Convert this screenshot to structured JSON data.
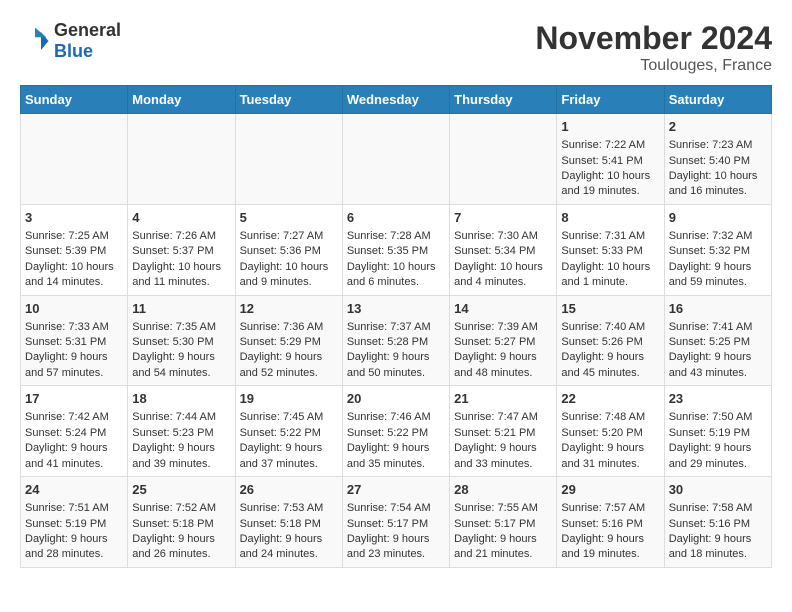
{
  "logo": {
    "general": "General",
    "blue": "Blue"
  },
  "title": "November 2024",
  "location": "Toulouges, France",
  "days_of_week": [
    "Sunday",
    "Monday",
    "Tuesday",
    "Wednesday",
    "Thursday",
    "Friday",
    "Saturday"
  ],
  "weeks": [
    [
      {
        "day": "",
        "info": ""
      },
      {
        "day": "",
        "info": ""
      },
      {
        "day": "",
        "info": ""
      },
      {
        "day": "",
        "info": ""
      },
      {
        "day": "",
        "info": ""
      },
      {
        "day": "1",
        "info": "Sunrise: 7:22 AM\nSunset: 5:41 PM\nDaylight: 10 hours and 19 minutes."
      },
      {
        "day": "2",
        "info": "Sunrise: 7:23 AM\nSunset: 5:40 PM\nDaylight: 10 hours and 16 minutes."
      }
    ],
    [
      {
        "day": "3",
        "info": "Sunrise: 7:25 AM\nSunset: 5:39 PM\nDaylight: 10 hours and 14 minutes."
      },
      {
        "day": "4",
        "info": "Sunrise: 7:26 AM\nSunset: 5:37 PM\nDaylight: 10 hours and 11 minutes."
      },
      {
        "day": "5",
        "info": "Sunrise: 7:27 AM\nSunset: 5:36 PM\nDaylight: 10 hours and 9 minutes."
      },
      {
        "day": "6",
        "info": "Sunrise: 7:28 AM\nSunset: 5:35 PM\nDaylight: 10 hours and 6 minutes."
      },
      {
        "day": "7",
        "info": "Sunrise: 7:30 AM\nSunset: 5:34 PM\nDaylight: 10 hours and 4 minutes."
      },
      {
        "day": "8",
        "info": "Sunrise: 7:31 AM\nSunset: 5:33 PM\nDaylight: 10 hours and 1 minute."
      },
      {
        "day": "9",
        "info": "Sunrise: 7:32 AM\nSunset: 5:32 PM\nDaylight: 9 hours and 59 minutes."
      }
    ],
    [
      {
        "day": "10",
        "info": "Sunrise: 7:33 AM\nSunset: 5:31 PM\nDaylight: 9 hours and 57 minutes."
      },
      {
        "day": "11",
        "info": "Sunrise: 7:35 AM\nSunset: 5:30 PM\nDaylight: 9 hours and 54 minutes."
      },
      {
        "day": "12",
        "info": "Sunrise: 7:36 AM\nSunset: 5:29 PM\nDaylight: 9 hours and 52 minutes."
      },
      {
        "day": "13",
        "info": "Sunrise: 7:37 AM\nSunset: 5:28 PM\nDaylight: 9 hours and 50 minutes."
      },
      {
        "day": "14",
        "info": "Sunrise: 7:39 AM\nSunset: 5:27 PM\nDaylight: 9 hours and 48 minutes."
      },
      {
        "day": "15",
        "info": "Sunrise: 7:40 AM\nSunset: 5:26 PM\nDaylight: 9 hours and 45 minutes."
      },
      {
        "day": "16",
        "info": "Sunrise: 7:41 AM\nSunset: 5:25 PM\nDaylight: 9 hours and 43 minutes."
      }
    ],
    [
      {
        "day": "17",
        "info": "Sunrise: 7:42 AM\nSunset: 5:24 PM\nDaylight: 9 hours and 41 minutes."
      },
      {
        "day": "18",
        "info": "Sunrise: 7:44 AM\nSunset: 5:23 PM\nDaylight: 9 hours and 39 minutes."
      },
      {
        "day": "19",
        "info": "Sunrise: 7:45 AM\nSunset: 5:22 PM\nDaylight: 9 hours and 37 minutes."
      },
      {
        "day": "20",
        "info": "Sunrise: 7:46 AM\nSunset: 5:22 PM\nDaylight: 9 hours and 35 minutes."
      },
      {
        "day": "21",
        "info": "Sunrise: 7:47 AM\nSunset: 5:21 PM\nDaylight: 9 hours and 33 minutes."
      },
      {
        "day": "22",
        "info": "Sunrise: 7:48 AM\nSunset: 5:20 PM\nDaylight: 9 hours and 31 minutes."
      },
      {
        "day": "23",
        "info": "Sunrise: 7:50 AM\nSunset: 5:19 PM\nDaylight: 9 hours and 29 minutes."
      }
    ],
    [
      {
        "day": "24",
        "info": "Sunrise: 7:51 AM\nSunset: 5:19 PM\nDaylight: 9 hours and 28 minutes."
      },
      {
        "day": "25",
        "info": "Sunrise: 7:52 AM\nSunset: 5:18 PM\nDaylight: 9 hours and 26 minutes."
      },
      {
        "day": "26",
        "info": "Sunrise: 7:53 AM\nSunset: 5:18 PM\nDaylight: 9 hours and 24 minutes."
      },
      {
        "day": "27",
        "info": "Sunrise: 7:54 AM\nSunset: 5:17 PM\nDaylight: 9 hours and 23 minutes."
      },
      {
        "day": "28",
        "info": "Sunrise: 7:55 AM\nSunset: 5:17 PM\nDaylight: 9 hours and 21 minutes."
      },
      {
        "day": "29",
        "info": "Sunrise: 7:57 AM\nSunset: 5:16 PM\nDaylight: 9 hours and 19 minutes."
      },
      {
        "day": "30",
        "info": "Sunrise: 7:58 AM\nSunset: 5:16 PM\nDaylight: 9 hours and 18 minutes."
      }
    ]
  ]
}
